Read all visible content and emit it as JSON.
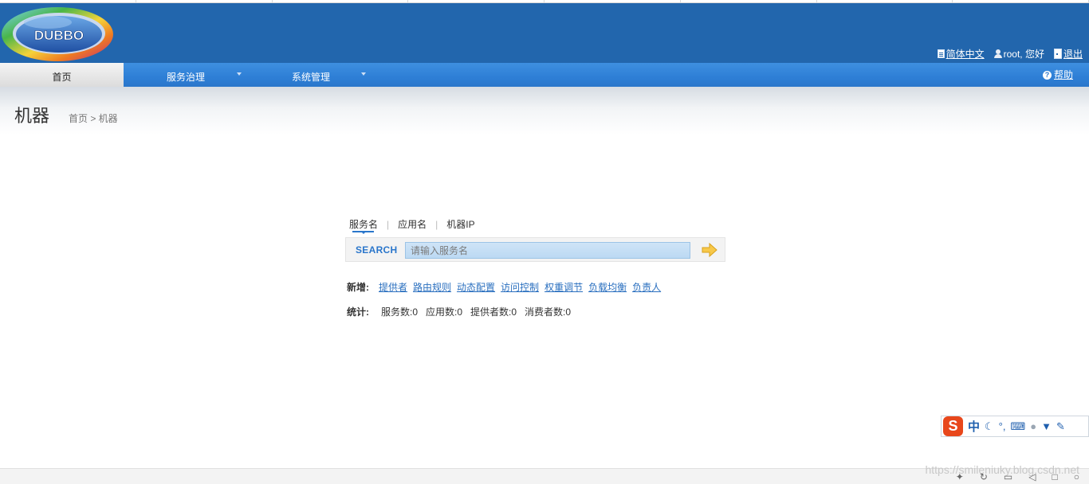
{
  "header": {
    "logo_text": "DUBBO",
    "language_link": "简体中文",
    "greeting": "root, 您好",
    "logout_link": "退出"
  },
  "nav": {
    "home": "首页",
    "service_governance": "服务治理",
    "system_management": "系统管理",
    "help": "帮助"
  },
  "page": {
    "title": "机器",
    "breadcrumb": "首页 > 机器"
  },
  "search": {
    "tabs": [
      "服务名",
      "应用名",
      "机器IP"
    ],
    "label": "SEARCH",
    "placeholder": "请输入服务名"
  },
  "new": {
    "label": "新增:",
    "links": [
      "提供者",
      "路由规则",
      "动态配置",
      "访问控制",
      "权重调节",
      "负载均衡",
      "负责人"
    ]
  },
  "stats": {
    "label": "统计:",
    "items": [
      "服务数:0",
      "应用数:0",
      "提供者数:0",
      "消费者数:0"
    ]
  },
  "ime": {
    "logo": "S",
    "mode": "中"
  },
  "watermark": "https://smileniuky.blog.csdn.net"
}
